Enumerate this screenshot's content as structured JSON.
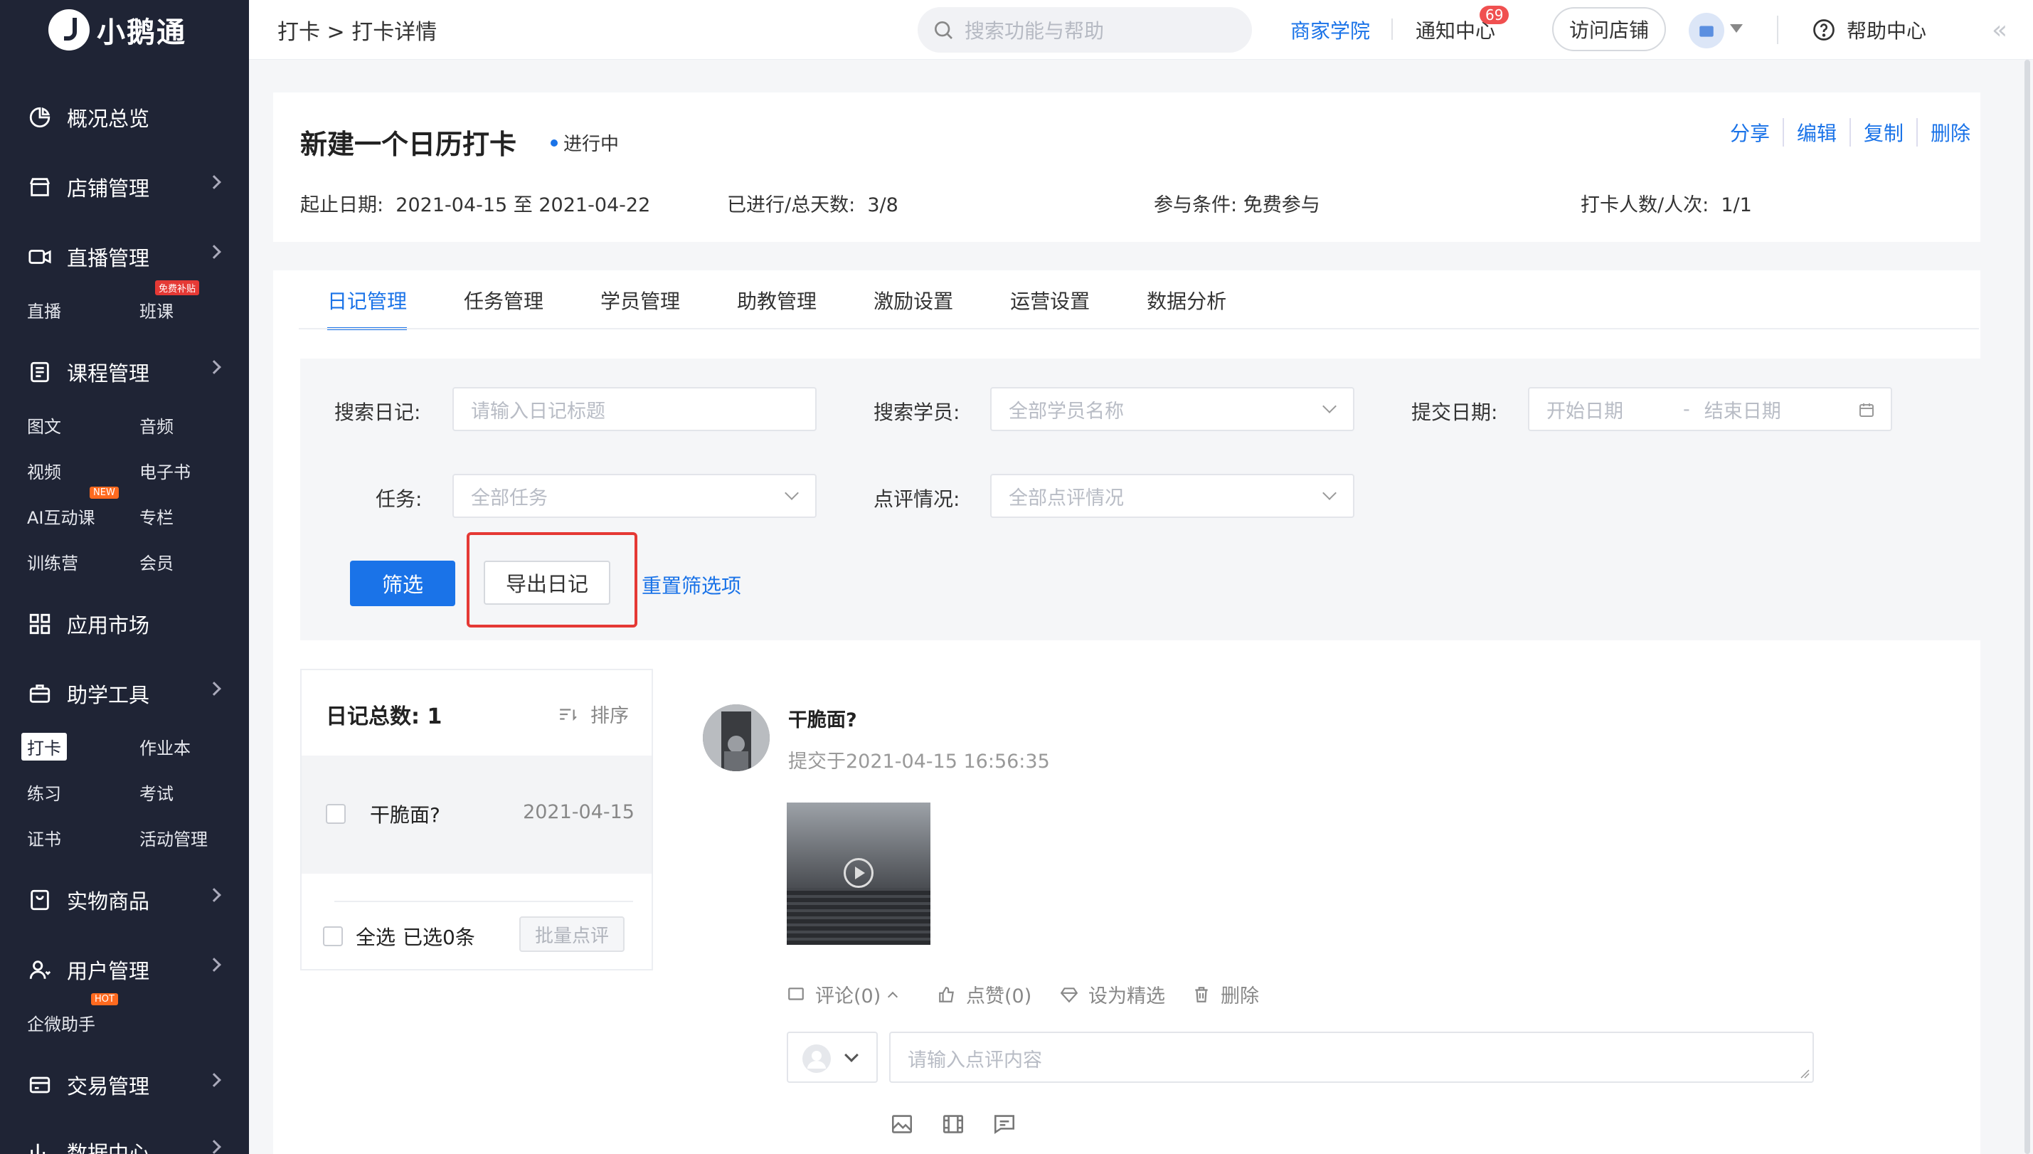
{
  "app": {
    "brand": "小鹅通"
  },
  "colors": {
    "accent": "#1a73e8",
    "sidebar_bg": "#1f2435",
    "danger": "#e53935"
  },
  "topbar": {
    "breadcrumb": "打卡 > 打卡详情",
    "search_placeholder": "搜索功能与帮助",
    "business_school": "商家学院",
    "notifications": "通知中心",
    "notification_count": "69",
    "visit_store": "访问店铺",
    "help": "帮助中心"
  },
  "sidebar": {
    "overview": "概况总览",
    "store": "店铺管理",
    "live": "直播管理",
    "live_sub": {
      "live": "直播",
      "class": "班课",
      "class_tag": "免费补贴"
    },
    "course": "课程管理",
    "course_sub": {
      "article": "图文",
      "audio": "音频",
      "video": "视频",
      "ebook": "电子书",
      "ai": "AI互动课",
      "ai_tag": "NEW",
      "column": "专栏",
      "camp": "训练营",
      "member": "会员"
    },
    "apps": "应用市场",
    "tools": "助学工具",
    "tools_sub": {
      "checkin": "打卡",
      "homework": "作业本",
      "practice": "练习",
      "exam": "考试",
      "certificate": "证书",
      "activity": "活动管理"
    },
    "goods": "实物商品",
    "users": "用户管理",
    "users_sub": {
      "wecom": "企微助手",
      "wecom_tag": "HOT"
    },
    "trade": "交易管理",
    "data": "数据中心"
  },
  "header": {
    "title": "新建一个日历打卡",
    "status": "进行中",
    "date_label": "起止日期:",
    "date_value": "2021-04-15 至 2021-04-22",
    "progress_label": "已进行/总天数:",
    "progress_value": "3/8",
    "condition_label": "参与条件:",
    "condition_value": "免费参与",
    "participants_label": "打卡人数/人次:",
    "participants_value": "1/1",
    "actions": {
      "share": "分享",
      "edit": "编辑",
      "copy": "复制",
      "delete": "删除"
    }
  },
  "tabs": [
    "日记管理",
    "任务管理",
    "学员管理",
    "助教管理",
    "激励设置",
    "运营设置",
    "数据分析"
  ],
  "filters": {
    "search_diary_label": "搜索日记:",
    "search_diary_placeholder": "请输入日记标题",
    "search_student_label": "搜索学员:",
    "search_student_placeholder": "全部学员名称",
    "date_label": "提交日期:",
    "date_start_placeholder": "开始日期",
    "date_separator": "-",
    "date_end_placeholder": "结束日期",
    "task_label": "任务:",
    "task_placeholder": "全部任务",
    "review_label": "点评情况:",
    "review_placeholder": "全部点评情况",
    "filter_button": "筛选",
    "export_button": "导出日记",
    "reset_link": "重置筛选项"
  },
  "diary_list": {
    "total_label": "日记总数:",
    "total_value": "1",
    "sort_label": "排序",
    "items": [
      {
        "title": "干脆面?",
        "date": "2021-04-15"
      }
    ],
    "select_all": "全选",
    "selected": "已选0条",
    "batch_review": "批量点评"
  },
  "diary_detail": {
    "title": "干脆面?",
    "submitted": "提交于2021-04-15 16:56:35",
    "ops": {
      "comment": "评论(0)",
      "like": "点赞(0)",
      "feature": "设为精选",
      "delete": "删除"
    },
    "comment_placeholder": "请输入点评内容"
  }
}
